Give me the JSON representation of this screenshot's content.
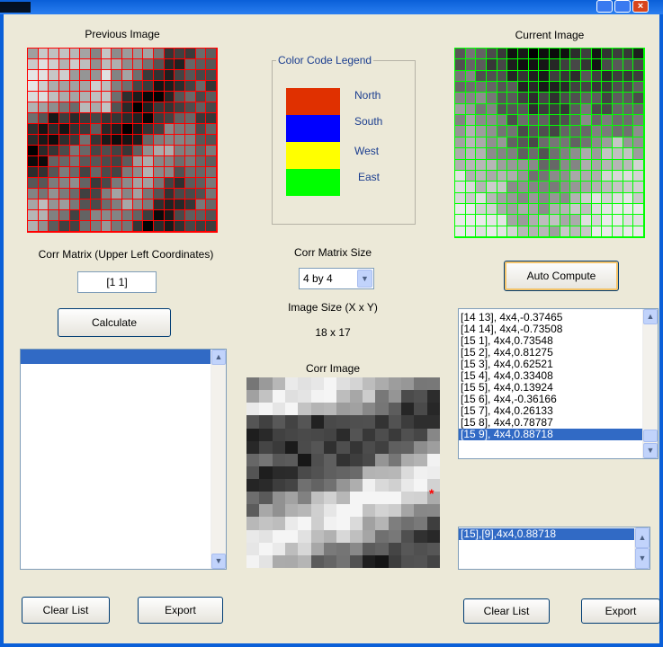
{
  "titles": {
    "previous_image": "Previous Image",
    "current_image": "Current Image",
    "legend": "Color Code Legend",
    "corr_matrix_coords": "Corr Matrix (Upper Left Coordinates)",
    "corr_matrix_size": "Corr Matrix Size",
    "image_size": "Image Size (X x Y)",
    "image_size_value": "18 x 17",
    "corr_image": "Corr Image"
  },
  "legend": [
    {
      "label": "North",
      "color": "#e03000"
    },
    {
      "label": "South",
      "color": "#0000ff"
    },
    {
      "label": "West",
      "color": "#ffff00"
    },
    {
      "label": "East",
      "color": "#00ff00"
    }
  ],
  "inputs": {
    "coords_value": "[1 1]",
    "size_selected": "4 by 4"
  },
  "buttons": {
    "calculate": "Calculate",
    "auto_compute": "Auto Compute",
    "clear_list_left": "Clear List",
    "export_left": "Export",
    "clear_list_right": "Clear List",
    "export_right": "Export"
  },
  "results_list": [
    "[14 13], 4x4,-0.37465",
    "[14 14], 4x4,-0.73508",
    "[15 1], 4x4,0.73548",
    "[15 2], 4x4,0.81275",
    "[15 3], 4x4,0.62521",
    "[15 4], 4x4,0.33408",
    "[15 5], 4x4,0.13924",
    "[15 6], 4x4,-0.36166",
    "[15 7], 4x4,0.26133",
    "[15 8], 4x4,0.78787",
    "[15 9], 4x4,0.88718"
  ],
  "selected_list": [
    "[15],[9],4x4,0.88718"
  ],
  "marker": "*",
  "colors": {
    "prev_grid": "#ff0000",
    "curr_grid": "#00ff00",
    "selection": "#316ac5",
    "marker": "#ff0000"
  }
}
